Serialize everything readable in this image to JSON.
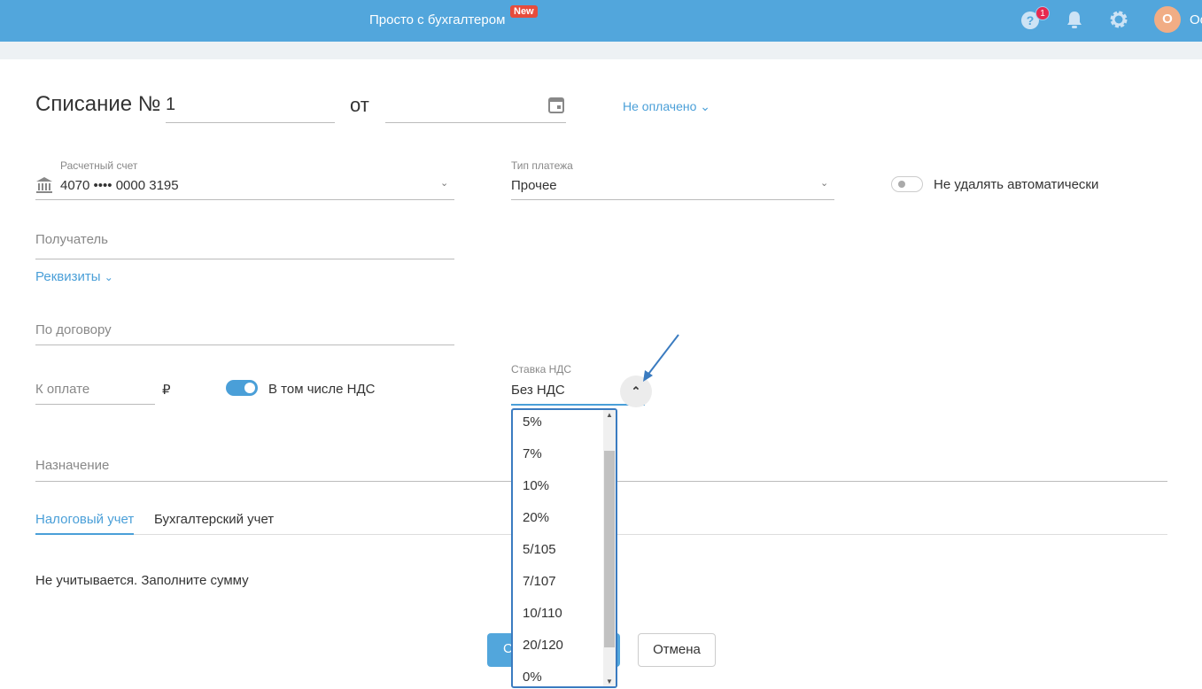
{
  "header": {
    "brand": "Просто с бухгалтером",
    "new_badge": "New",
    "help_count": "1",
    "avatar_letter": "О",
    "user_name": "Оо"
  },
  "form": {
    "title": "Списание №",
    "number": "1",
    "from_label": "от",
    "date": "",
    "status": "Не оплачено",
    "account_label": "Расчетный счет",
    "account_value": "4070 •••• 0000 3195",
    "payment_type_label": "Тип платежа",
    "payment_type_value": "Прочее",
    "auto_delete_label": "Не удалять автоматически",
    "recipient_placeholder": "Получатель",
    "details_link": "Реквизиты",
    "contract_placeholder": "По договору",
    "amount_placeholder": "К оплате",
    "currency": "₽",
    "vat_included_label": "В том числе НДС",
    "vat_rate_label": "Ставка НДС",
    "vat_rate_value": "Без НДС",
    "purpose_placeholder": "Назначение"
  },
  "tabs": [
    {
      "label": "Налоговый учет",
      "active": true
    },
    {
      "label": "Бухгалтерский учет",
      "active": false
    }
  ],
  "tax_note": "Не учитывается. Заполните сумму",
  "buttons": {
    "save": "Сохранить",
    "cancel": "Отмена"
  },
  "vat_options": [
    "5%",
    "7%",
    "10%",
    "20%",
    "5/105",
    "7/107",
    "10/110",
    "20/120",
    "0%"
  ],
  "colors": {
    "accent": "#52a6dc",
    "link": "#4a9fd8",
    "badge": "#e8294f"
  }
}
